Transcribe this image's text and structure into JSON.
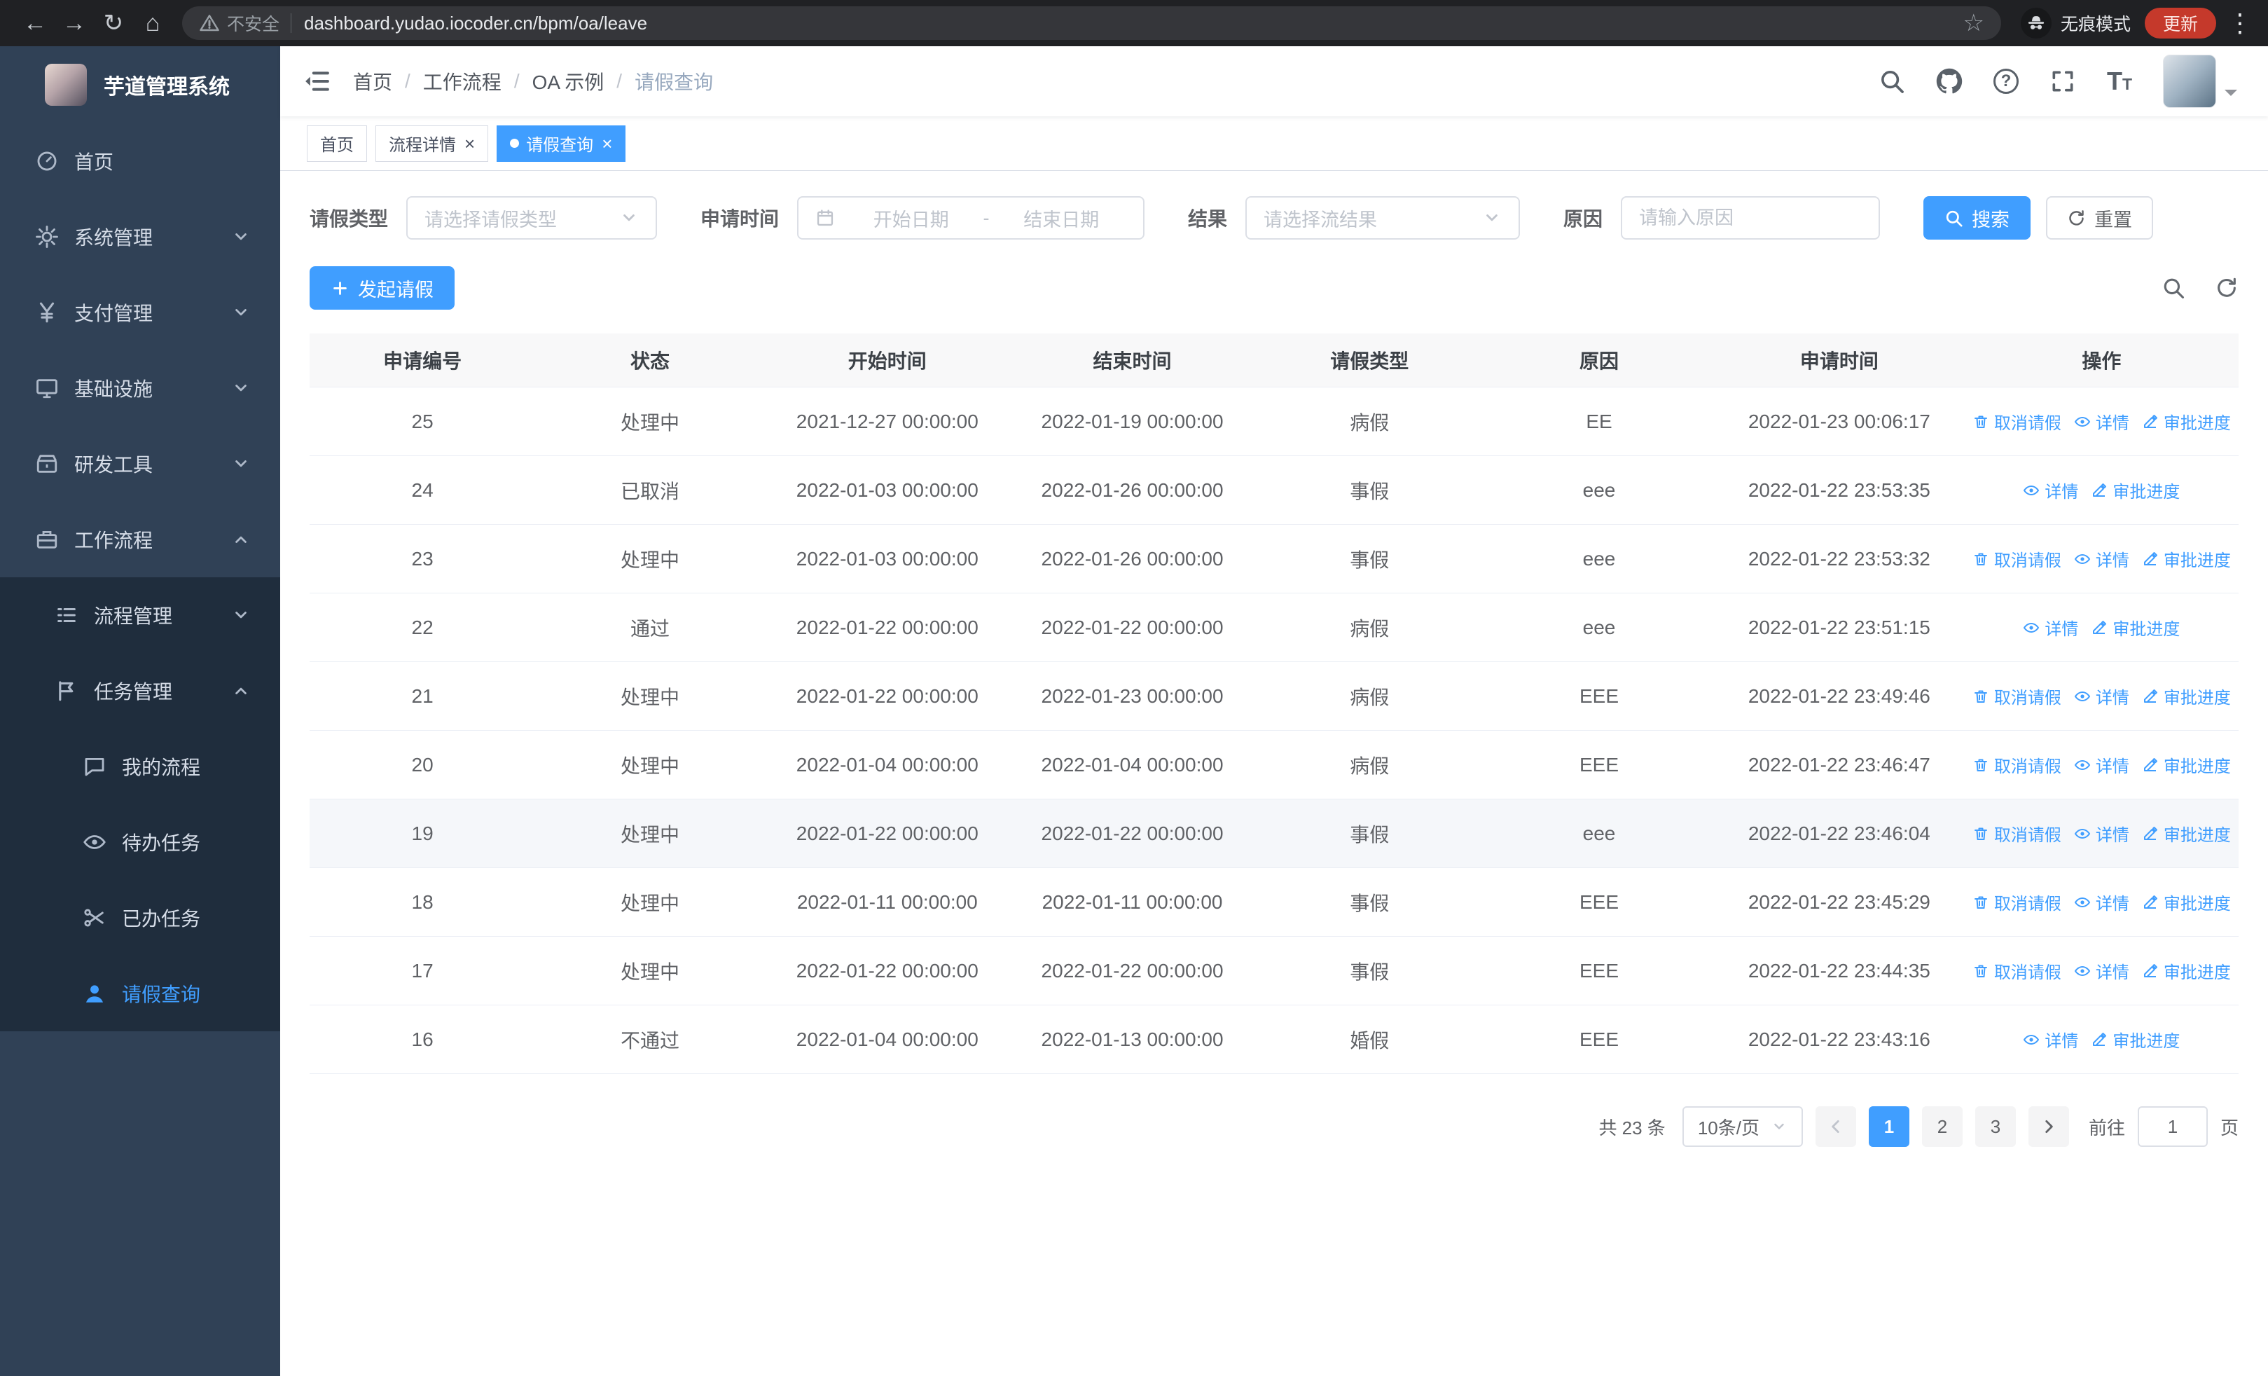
{
  "colors": {
    "primary": "#409eff"
  },
  "browser": {
    "security_label": "不安全",
    "url": "dashboard.yudao.iocoder.cn/bpm/oa/leave",
    "incognito_label": "无痕模式",
    "update_label": "更新"
  },
  "sidebar": {
    "logo_title": "芋道管理系统",
    "menu": [
      {
        "label": "首页",
        "icon": "dashboard-icon",
        "level": 1,
        "chevron": null,
        "active": false
      },
      {
        "label": "系统管理",
        "icon": "gear-icon",
        "level": 1,
        "chevron": "down",
        "active": false
      },
      {
        "label": "支付管理",
        "icon": "yen-icon",
        "level": 1,
        "chevron": "down",
        "active": false
      },
      {
        "label": "基础设施",
        "icon": "monitor-icon",
        "level": 1,
        "chevron": "down",
        "active": false
      },
      {
        "label": "研发工具",
        "icon": "toolbox-icon",
        "level": 1,
        "chevron": "down",
        "active": false
      },
      {
        "label": "工作流程",
        "icon": "briefcase-icon",
        "level": 1,
        "chevron": "up",
        "active": false
      },
      {
        "label": "流程管理",
        "icon": "list-icon",
        "level": 2,
        "chevron": "down",
        "active": false
      },
      {
        "label": "任务管理",
        "icon": "flag-icon",
        "level": 2,
        "chevron": "up",
        "active": false
      },
      {
        "label": "我的流程",
        "icon": "chat-icon",
        "level": 3,
        "chevron": null,
        "active": false
      },
      {
        "label": "待办任务",
        "icon": "eye-icon",
        "level": 3,
        "chevron": null,
        "active": false
      },
      {
        "label": "已办任务",
        "icon": "scissors-icon",
        "level": 3,
        "chevron": null,
        "active": false
      },
      {
        "label": "请假查询",
        "icon": "user-icon",
        "level": 3,
        "chevron": null,
        "active": true
      }
    ]
  },
  "navbar": {
    "separator": "/",
    "breadcrumb": [
      "首页",
      "工作流程",
      "OA 示例",
      "请假查询"
    ]
  },
  "tabs": [
    {
      "label": "首页",
      "closable": false,
      "active": false
    },
    {
      "label": "流程详情",
      "closable": true,
      "active": false
    },
    {
      "label": "请假查询",
      "closable": true,
      "active": true
    }
  ],
  "filters": {
    "leave_type_label": "请假类型",
    "leave_type_placeholder": "请选择请假类型",
    "apply_time_label": "申请时间",
    "date_start_placeholder": "开始日期",
    "date_separator": "-",
    "date_end_placeholder": "结束日期",
    "result_label": "结果",
    "result_placeholder": "请选择流结果",
    "reason_label": "原因",
    "reason_placeholder": "请输入原因",
    "search_label": "搜索",
    "reset_label": "重置"
  },
  "toolbar": {
    "create_label": "发起请假"
  },
  "table": {
    "columns": [
      "申请编号",
      "状态",
      "开始时间",
      "结束时间",
      "请假类型",
      "原因",
      "申请时间",
      "操作"
    ],
    "action_labels": {
      "cancel": "取消请假",
      "detail": "详情",
      "progress": "审批进度"
    },
    "rows": [
      {
        "id": "25",
        "status": "处理中",
        "start": "2021-12-27 00:00:00",
        "end": "2022-01-19 00:00:00",
        "type": "病假",
        "reason": "EE",
        "applied": "2022-01-23 00:06:17",
        "can_cancel": true,
        "highlight": false
      },
      {
        "id": "24",
        "status": "已取消",
        "start": "2022-01-03 00:00:00",
        "end": "2022-01-26 00:00:00",
        "type": "事假",
        "reason": "eee",
        "applied": "2022-01-22 23:53:35",
        "can_cancel": false,
        "highlight": false
      },
      {
        "id": "23",
        "status": "处理中",
        "start": "2022-01-03 00:00:00",
        "end": "2022-01-26 00:00:00",
        "type": "事假",
        "reason": "eee",
        "applied": "2022-01-22 23:53:32",
        "can_cancel": true,
        "highlight": false
      },
      {
        "id": "22",
        "status": "通过",
        "start": "2022-01-22 00:00:00",
        "end": "2022-01-22 00:00:00",
        "type": "病假",
        "reason": "eee",
        "applied": "2022-01-22 23:51:15",
        "can_cancel": false,
        "highlight": false
      },
      {
        "id": "21",
        "status": "处理中",
        "start": "2022-01-22 00:00:00",
        "end": "2022-01-23 00:00:00",
        "type": "病假",
        "reason": "EEE",
        "applied": "2022-01-22 23:49:46",
        "can_cancel": true,
        "highlight": false
      },
      {
        "id": "20",
        "status": "处理中",
        "start": "2022-01-04 00:00:00",
        "end": "2022-01-04 00:00:00",
        "type": "病假",
        "reason": "EEE",
        "applied": "2022-01-22 23:46:47",
        "can_cancel": true,
        "highlight": false
      },
      {
        "id": "19",
        "status": "处理中",
        "start": "2022-01-22 00:00:00",
        "end": "2022-01-22 00:00:00",
        "type": "事假",
        "reason": "eee",
        "applied": "2022-01-22 23:46:04",
        "can_cancel": true,
        "highlight": true
      },
      {
        "id": "18",
        "status": "处理中",
        "start": "2022-01-11 00:00:00",
        "end": "2022-01-11 00:00:00",
        "type": "事假",
        "reason": "EEE",
        "applied": "2022-01-22 23:45:29",
        "can_cancel": true,
        "highlight": false
      },
      {
        "id": "17",
        "status": "处理中",
        "start": "2022-01-22 00:00:00",
        "end": "2022-01-22 00:00:00",
        "type": "事假",
        "reason": "EEE",
        "applied": "2022-01-22 23:44:35",
        "can_cancel": true,
        "highlight": false
      },
      {
        "id": "16",
        "status": "不通过",
        "start": "2022-01-04 00:00:00",
        "end": "2022-01-13 00:00:00",
        "type": "婚假",
        "reason": "EEE",
        "applied": "2022-01-22 23:43:16",
        "can_cancel": false,
        "highlight": false
      }
    ]
  },
  "pagination": {
    "total_text": "共 23 条",
    "page_size_text": "10条/页",
    "pages": [
      "1",
      "2",
      "3"
    ],
    "active_page": "1",
    "goto_label": "前往",
    "goto_value": "1",
    "page_suffix": "页"
  }
}
